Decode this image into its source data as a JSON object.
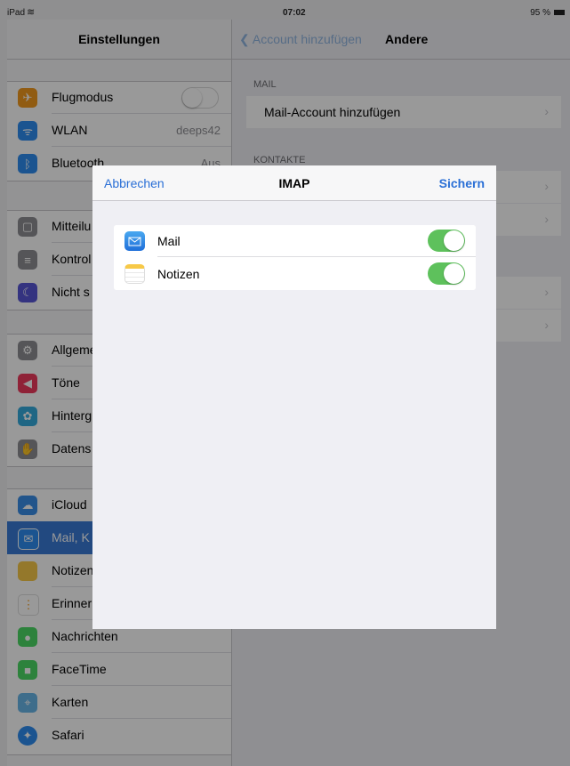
{
  "status": {
    "device": "iPad",
    "time": "07:02",
    "battery": "95 %"
  },
  "sidebar": {
    "title": "Einstellungen",
    "items": [
      {
        "label": "Flugmodus",
        "icon": "airplane-icon",
        "color": "#f29a1f",
        "toggle": "off"
      },
      {
        "label": "WLAN",
        "value": "deeps42",
        "icon": "wifi-icon",
        "color": "#2d8cf0"
      },
      {
        "label": "Bluetooth",
        "value": "Aus",
        "icon": "bluetooth-icon",
        "color": "#2d8cf0"
      },
      {
        "label": "Mitteilu",
        "icon": "notifications-icon",
        "color": "#8e8e93"
      },
      {
        "label": "Kontrol",
        "icon": "control-center-icon",
        "color": "#8e8e93"
      },
      {
        "label": "Nicht s",
        "icon": "moon-icon",
        "color": "#5856d6"
      },
      {
        "label": "Allgeme",
        "icon": "gear-icon",
        "color": "#8e8e93"
      },
      {
        "label": "Töne",
        "icon": "speaker-icon",
        "color": "#ef3a5d"
      },
      {
        "label": "Hinterg",
        "icon": "wallpaper-icon",
        "color": "#34aadc"
      },
      {
        "label": "Datens",
        "icon": "hand-icon",
        "color": "#8e8e93"
      },
      {
        "label": "iCloud",
        "icon": "cloud-icon",
        "color": "#3a8ee8"
      },
      {
        "label": "Mail, K",
        "icon": "mail-icon",
        "color": "#2d8cf0"
      },
      {
        "label": "Notizen",
        "icon": "notes-icon",
        "color": "#f7c948"
      },
      {
        "label": "Erinner",
        "icon": "reminders-icon",
        "color": "#ffffff"
      },
      {
        "label": "Nachrichten",
        "icon": "messages-icon",
        "color": "#4cd964"
      },
      {
        "label": "FaceTime",
        "icon": "facetime-icon",
        "color": "#4cd964"
      },
      {
        "label": "Karten",
        "icon": "maps-icon",
        "color": "#68b6e8"
      },
      {
        "label": "Safari",
        "icon": "safari-icon",
        "color": "#2d8cf0"
      }
    ]
  },
  "detail": {
    "back_label": "Account hinzufügen",
    "title": "Andere",
    "mail_header": "MAIL",
    "add_mail_account": "Mail-Account hinzufügen",
    "contacts_header": "KONTAKTE"
  },
  "modal": {
    "cancel_label": "Abbrechen",
    "title": "IMAP",
    "save_label": "Sichern",
    "rows": [
      {
        "label": "Mail",
        "icon": "mail-icon",
        "toggle": "on"
      },
      {
        "label": "Notizen",
        "icon": "notes-icon",
        "toggle": "on"
      }
    ]
  }
}
